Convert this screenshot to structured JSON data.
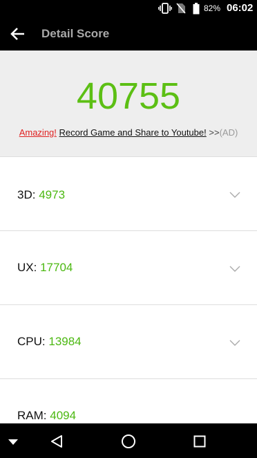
{
  "status_bar": {
    "battery_percent": "82%",
    "time": "06:02",
    "icons": [
      "vibrate-icon",
      "no-sim-icon",
      "battery-icon"
    ]
  },
  "app_bar": {
    "title": "Detail Score",
    "back_icon": "arrow-left-icon"
  },
  "score_header": {
    "total_score": "40755",
    "ad": {
      "amazing": "Amazing!",
      "link_text": "Record Game and Share to Youtube!",
      "arrows": ">>",
      "tag": "(AD)"
    }
  },
  "scores": [
    {
      "label": "3D:",
      "value": "4973"
    },
    {
      "label": "UX:",
      "value": "17704"
    },
    {
      "label": "CPU:",
      "value": "13984"
    },
    {
      "label": "RAM:",
      "value": "4094"
    }
  ],
  "nav_bar": {
    "icons": [
      "expand-down-icon",
      "back-triangle-icon",
      "home-circle-icon",
      "recents-square-icon"
    ]
  },
  "colors": {
    "accent_green": "#5cbf14",
    "ad_red": "#e02020",
    "header_bg": "#eeeeee",
    "bar_bg": "#000000"
  }
}
